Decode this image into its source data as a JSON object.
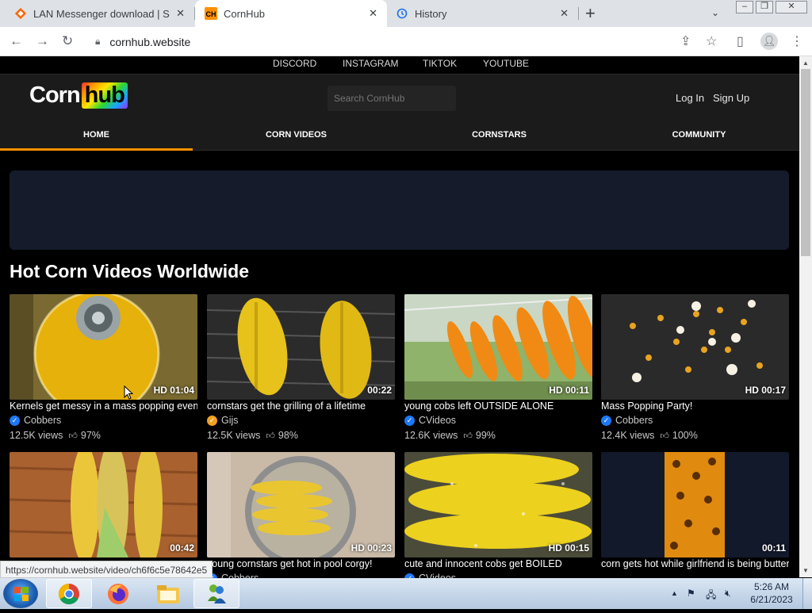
{
  "browser": {
    "tabs": [
      {
        "title": "LAN Messenger download | SourceForge",
        "active": false
      },
      {
        "title": "CornHub",
        "active": true
      },
      {
        "title": "History",
        "active": false
      }
    ],
    "url": "cornhub.website",
    "status_url": "https://cornhub.website/video/ch6f6c5e78642e5"
  },
  "site": {
    "top_links": [
      "DISCORD",
      "INSTAGRAM",
      "TIKTOK",
      "YOUTUBE"
    ],
    "logo": {
      "part1": "Corn",
      "part2": "hub"
    },
    "search_placeholder": "Search CornHub",
    "login": "Log In",
    "signup": "Sign Up",
    "menu": [
      "HOME",
      "CORN VIDEOS",
      "CORNSTARS",
      "COMMUNITY"
    ],
    "active_menu": "HOME",
    "accent_color": "#ff9000",
    "section_title": "Hot Corn Videos Worldwide",
    "videos": [
      {
        "title": "Kernels get messy in a mass popping event",
        "duration": "HD 01:04",
        "channel": "Cobbers",
        "views": "12.5K views",
        "rating": "97%",
        "verified_color": "blue"
      },
      {
        "title": "cornstars get the grilling of a lifetime",
        "duration": "00:22",
        "channel": "Gijs",
        "views": "12.5K views",
        "rating": "98%",
        "verified_color": "gold"
      },
      {
        "title": "young cobs left OUTSIDE ALONE",
        "duration": "HD 00:11",
        "channel": "CVideos",
        "views": "12.6K views",
        "rating": "99%",
        "verified_color": "blue"
      },
      {
        "title": "Mass Popping Party!",
        "duration": "HD 00:17",
        "channel": "Cobbers",
        "views": "12.4K views",
        "rating": "100%",
        "verified_color": "blue"
      },
      {
        "title": "",
        "duration": "00:42"
      },
      {
        "title": "young cornstars get hot in pool corgy!",
        "duration": "HD 00:23",
        "channel": "Cobbers"
      },
      {
        "title": "cute and innocent cobs get BOILED",
        "duration": "HD 00:15",
        "channel": "CVideos"
      },
      {
        "title": "corn gets hot while girlfriend is being buttered",
        "duration": "00:11"
      }
    ]
  },
  "taskbar": {
    "time": "5:26 AM",
    "date": "6/21/2023",
    "apps": [
      "chrome-icon",
      "firefox-icon",
      "file-explorer-icon",
      "lan-messenger-icon"
    ]
  }
}
